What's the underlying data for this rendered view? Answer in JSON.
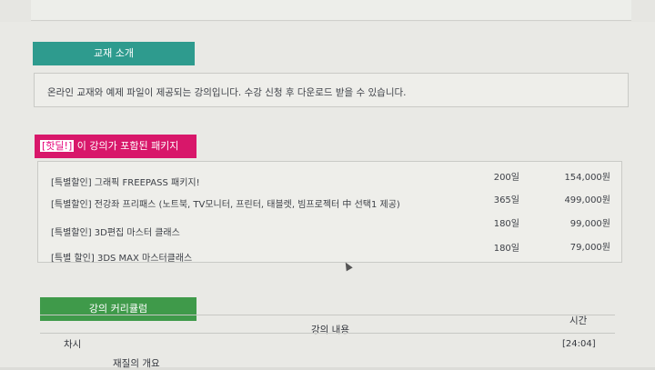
{
  "intro": {
    "label": "교재 소개",
    "text": "온라인 교재와 예제 파일이 제공되는 강의입니다. 수강 신청 후 다운로드 받을 수 있습니다."
  },
  "packages": {
    "label_hot": "[핫딜!]",
    "label_rest": "이 강의가 포함된 패키지",
    "items": [
      {
        "name": "[특별할인] 그래픽 FREEPASS 패키지!",
        "days": "200일",
        "price": "154,000원"
      },
      {
        "name": "[특별할인] 전강좌 프리패스 (노트북, TV모니터, 프린터, 태블렛, 빔프로젝터 中 선택1 제공)",
        "days": "365일",
        "price": "499,000원"
      },
      {
        "name": "[특별할인] 3D편집 마스터 클래스",
        "days": "180일",
        "price": "99,000원"
      },
      {
        "name": "[특별 할인] 3DS MAX 마스터클래스",
        "days": "180일",
        "price": "79,000원"
      }
    ]
  },
  "curriculum": {
    "label": "강의 커리큘럼",
    "col_no": "차시",
    "col_content": "강의 내용",
    "col_time": "시간",
    "first_row": {
      "title": "재질의 개요",
      "time": "[24:04]"
    }
  },
  "colors": {
    "teal": "#2e9b8e",
    "magenta": "#d8176a",
    "green": "#3f9a4a"
  }
}
